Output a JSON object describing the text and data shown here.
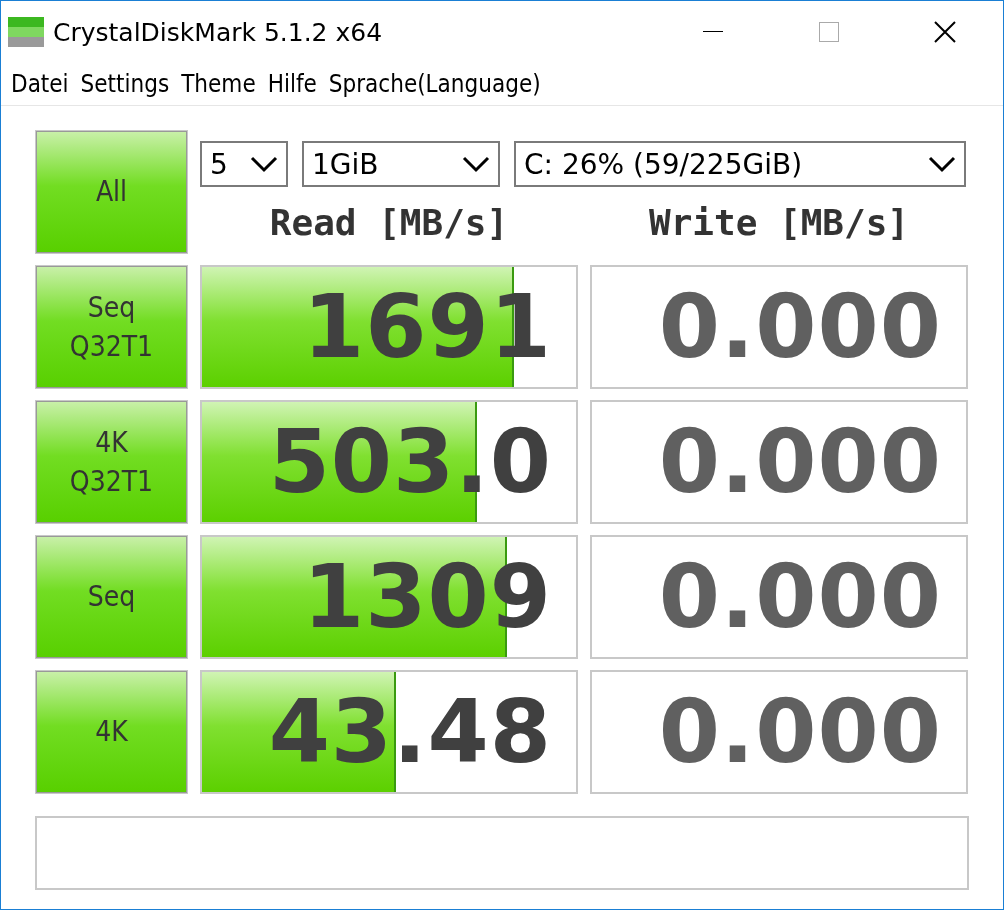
{
  "window": {
    "title": "CrystalDiskMark 5.1.2 x64"
  },
  "menu": [
    "Datei",
    "Settings",
    "Theme",
    "Hilfe",
    "Sprache(Language)"
  ],
  "controls": {
    "all_button": "All",
    "count": "5",
    "size": "1GiB",
    "drive": "C: 26% (59/225GiB)"
  },
  "headers": {
    "read": "Read [MB/s]",
    "write": "Write [MB/s]"
  },
  "rows": [
    {
      "label": [
        "Seq",
        "Q32T1"
      ],
      "read": {
        "value": "1691",
        "level": 0.835
      },
      "write": {
        "value": "0.000"
      }
    },
    {
      "label": [
        "4K",
        "Q32T1"
      ],
      "read": {
        "value": "503.0",
        "level": 0.735
      },
      "write": {
        "value": "0.000"
      }
    },
    {
      "label": [
        "Seq"
      ],
      "read": {
        "value": "1309",
        "level": 0.815
      },
      "write": {
        "value": "0.000"
      }
    },
    {
      "label": [
        "4K"
      ],
      "read": {
        "value": "43.48",
        "level": 0.52
      },
      "write": {
        "value": "0.000"
      }
    }
  ]
}
